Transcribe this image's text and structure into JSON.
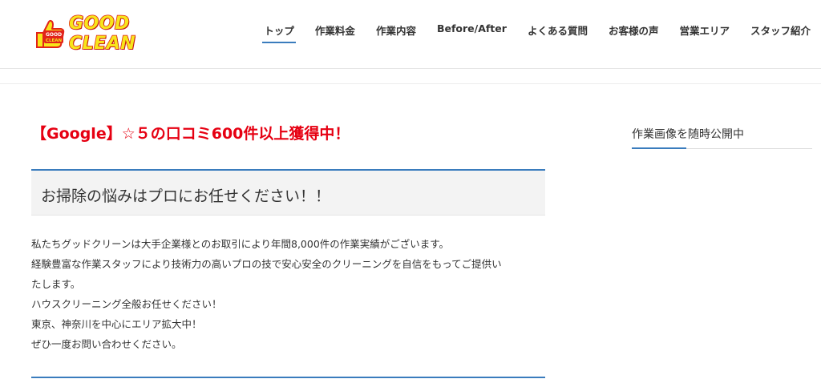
{
  "header": {
    "logo": {
      "badge_top": "GOOD",
      "badge_bottom": "CLEAN",
      "wordmark": "GOOD CLEAN"
    },
    "nav": [
      {
        "label": "トップ",
        "active": true
      },
      {
        "label": "作業料金"
      },
      {
        "label": "作業内容"
      },
      {
        "label": "Before/After"
      },
      {
        "label": "よくある質問"
      },
      {
        "label": "お客様の声"
      },
      {
        "label": "営業エリア"
      },
      {
        "label": "スタッフ紹介"
      }
    ]
  },
  "main": {
    "promo": "【Google】☆５の口コミ600件以上獲得中！",
    "heading": "お掃除の悩みはプロにお任せください！！",
    "paragraph": [
      "私たちグッドクリーンは大手企業様とのお取引により年間8,000件の作業実績がございます。",
      "経験豊富な作業スタッフにより技術力の高いプロの技で安心安全のクリーニングを自信をもってご提供い",
      "たします。",
      "ハウスクリーニング全般お任せください！",
      "東京、神奈川を中心にエリア拡大中！",
      "ぜひ一度お問い合わせください。"
    ]
  },
  "sidebar": {
    "title": "作業画像を随時公開中"
  },
  "colors": {
    "accent": "#3a7cbd",
    "promo_red": "#e60012",
    "logo_yellow": "#f7e51b",
    "logo_red": "#e2231a"
  }
}
